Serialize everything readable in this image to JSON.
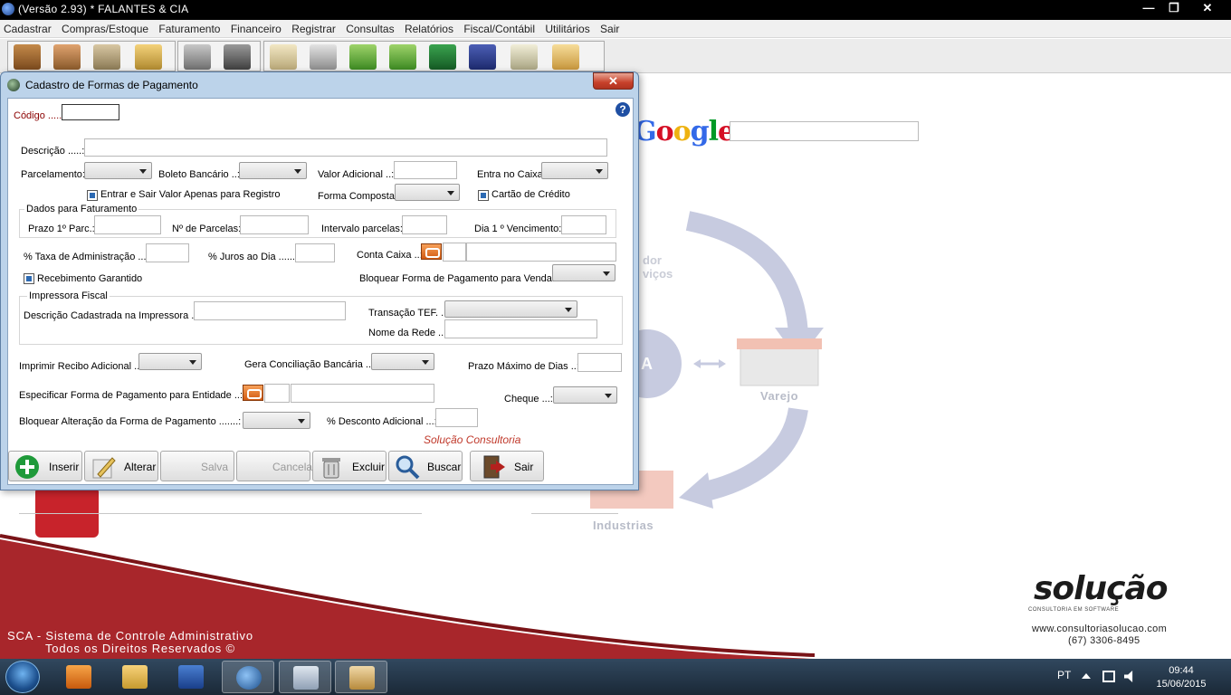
{
  "window": {
    "title": "(Versão 2.93) *   FALANTES & CIA",
    "minimize": "—",
    "restore": "❐",
    "close": "✕"
  },
  "menu": [
    "Cadastrar",
    "Compras/Estoque",
    "Faturamento",
    "Financeiro",
    "Registrar",
    "Consultas",
    "Relatórios",
    "Fiscal/Contábil",
    "Utilitários",
    "Sair"
  ],
  "background": {
    "google_search_value": "",
    "cycle_labels": {
      "distributor": "dor\nviços",
      "retail": "Varejo",
      "industry": "Industrias"
    },
    "footer_line1": "SCA - Sistema de Controle Administrativo",
    "footer_line2": "Todos os Direitos Reservados ©",
    "brand_name": "solução",
    "brand_subtitle": "CONSULTORIA EM SOFTWARE",
    "brand_url": "www.consultoriasolucao.com",
    "brand_phone": "(67) 3306-8495",
    "colors": {
      "footer_red": "#a8262b",
      "brand_red": "#c0392b",
      "dialog_border": "#bcd3ea"
    }
  },
  "dialog": {
    "title": "Cadastro de Formas de Pagamento",
    "close": "✕",
    "help": "?",
    "codigo_label": "Código .....:",
    "codigo_value": "",
    "descricao_label": "Descrição .....:",
    "descricao_value": "",
    "parcelamento_label": "Parcelamento:",
    "boleto_label": "Boleto Bancário ..:",
    "valor_adicional_label": "Valor Adicional ..:",
    "entra_caixa_label": "Entra no Caixa",
    "entrar_sair_label": "Entrar e Sair Valor Apenas para Registro",
    "forma_composta_label": "Forma Composta:",
    "cartao_credito_label": "Cartão de Crédito",
    "faturamento_group": "Dados para Faturamento",
    "prazo_label": "Prazo 1º Parc.:",
    "num_parcelas_label": "Nº de Parcelas:",
    "intervalo_label": "Intervalo parcelas:",
    "dia_venc_label": "Dia 1 º Vencimento:",
    "taxa_adm_label": "% Taxa de Administração ...:",
    "juros_dia_label": "% Juros ao Dia ......:",
    "conta_caixa_label": "Conta Caixa ..:",
    "recebimento_label": "Recebimento Garantido",
    "bloquear_venda_label": "Bloquear Forma de Pagamento para Venda.:",
    "impressora_group": "Impressora Fiscal",
    "descricao_impressora_label": "Descrição Cadastrada na Impressora ..:",
    "transacao_tef_label": "Transação TEF. ..:",
    "nome_rede_label": "Nome da Rede ..:",
    "imprimir_recibo_label": "Imprimir Recibo Adicional ..:",
    "gera_conciliacao_label": "Gera Conciliação Bancária ..:",
    "prazo_maximo_label": "Prazo Máximo de Dias ..:",
    "especificar_label": "Especificar Forma de Pagamento para Entidade ..:",
    "cheque_label": "Cheque ...:",
    "bloquear_alteracao_label": "Bloquear Alteração da Forma de Pagamento .......:",
    "desconto_label": "% Desconto Adicional ...:",
    "brand_line": "Solução Consultoria",
    "buttons": {
      "inserir": "Inserir",
      "alterar": "Alterar",
      "salva": "Salva",
      "cancela": "Cancela",
      "excluir": "Excluir",
      "buscar": "Buscar",
      "sair": "Sair"
    }
  },
  "taskbar": {
    "language": "PT",
    "time": "09:44",
    "date": "15/06/2015"
  }
}
